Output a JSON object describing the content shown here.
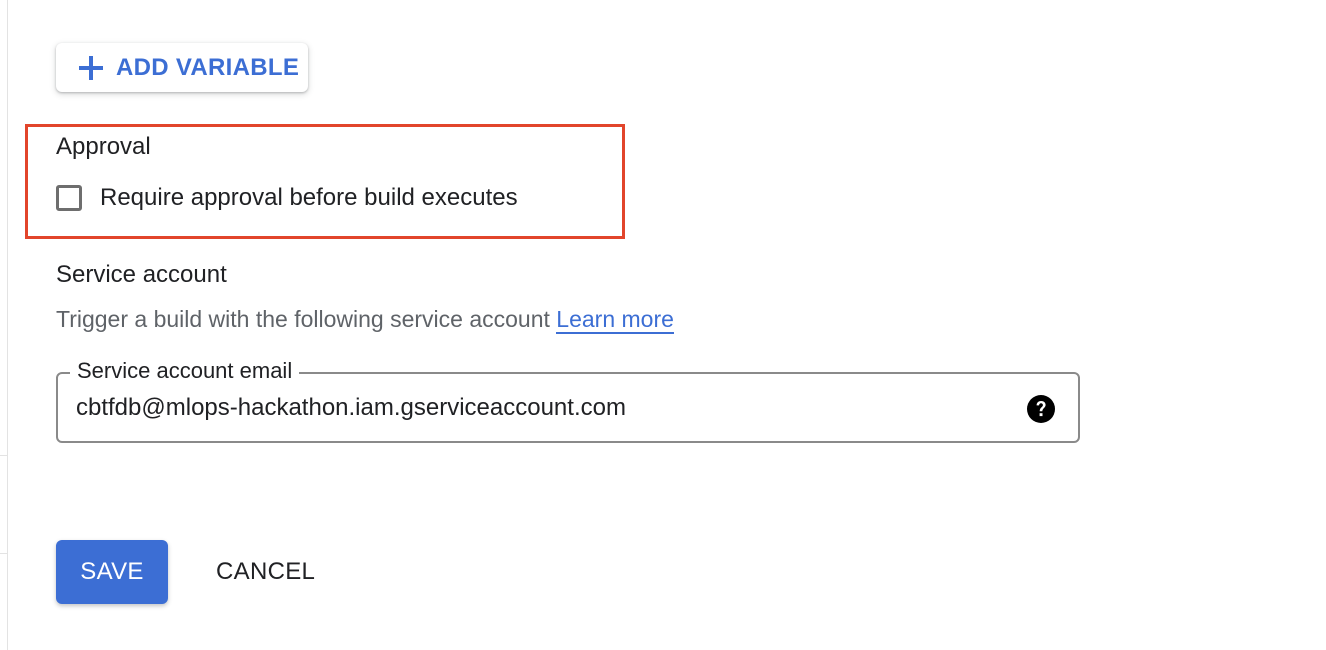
{
  "toolbar": {
    "add_variable_label": "ADD VARIABLE",
    "add_icon": "plus-icon"
  },
  "approval": {
    "title": "Approval",
    "checkbox_label": "Require approval before build executes",
    "checked": false,
    "highlight_color": "#e2452b"
  },
  "service_account": {
    "title": "Service account",
    "description": "Trigger a build with the following service account",
    "learn_more": "Learn more",
    "field_label": "Service account email",
    "field_value": "cbtfdb@mlops-hackathon.iam.gserviceaccount.com",
    "help_icon": "help-circle-icon"
  },
  "actions": {
    "save_label": "SAVE",
    "cancel_label": "CANCEL"
  },
  "colors": {
    "accent": "#3c6ed4",
    "highlight": "#e2452b"
  }
}
